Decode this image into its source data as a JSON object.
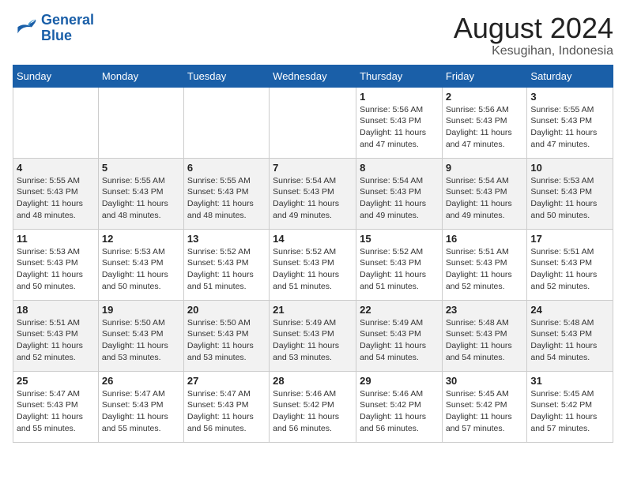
{
  "logo": {
    "text_general": "General",
    "text_blue": "Blue"
  },
  "title": {
    "month_year": "August 2024",
    "location": "Kesugihan, Indonesia"
  },
  "weekdays": [
    "Sunday",
    "Monday",
    "Tuesday",
    "Wednesday",
    "Thursday",
    "Friday",
    "Saturday"
  ],
  "weeks": [
    [
      {
        "day": "",
        "info": ""
      },
      {
        "day": "",
        "info": ""
      },
      {
        "day": "",
        "info": ""
      },
      {
        "day": "",
        "info": ""
      },
      {
        "day": "1",
        "info": "Sunrise: 5:56 AM\nSunset: 5:43 PM\nDaylight: 11 hours\nand 47 minutes."
      },
      {
        "day": "2",
        "info": "Sunrise: 5:56 AM\nSunset: 5:43 PM\nDaylight: 11 hours\nand 47 minutes."
      },
      {
        "day": "3",
        "info": "Sunrise: 5:55 AM\nSunset: 5:43 PM\nDaylight: 11 hours\nand 47 minutes."
      }
    ],
    [
      {
        "day": "4",
        "info": "Sunrise: 5:55 AM\nSunset: 5:43 PM\nDaylight: 11 hours\nand 48 minutes."
      },
      {
        "day": "5",
        "info": "Sunrise: 5:55 AM\nSunset: 5:43 PM\nDaylight: 11 hours\nand 48 minutes."
      },
      {
        "day": "6",
        "info": "Sunrise: 5:55 AM\nSunset: 5:43 PM\nDaylight: 11 hours\nand 48 minutes."
      },
      {
        "day": "7",
        "info": "Sunrise: 5:54 AM\nSunset: 5:43 PM\nDaylight: 11 hours\nand 49 minutes."
      },
      {
        "day": "8",
        "info": "Sunrise: 5:54 AM\nSunset: 5:43 PM\nDaylight: 11 hours\nand 49 minutes."
      },
      {
        "day": "9",
        "info": "Sunrise: 5:54 AM\nSunset: 5:43 PM\nDaylight: 11 hours\nand 49 minutes."
      },
      {
        "day": "10",
        "info": "Sunrise: 5:53 AM\nSunset: 5:43 PM\nDaylight: 11 hours\nand 50 minutes."
      }
    ],
    [
      {
        "day": "11",
        "info": "Sunrise: 5:53 AM\nSunset: 5:43 PM\nDaylight: 11 hours\nand 50 minutes."
      },
      {
        "day": "12",
        "info": "Sunrise: 5:53 AM\nSunset: 5:43 PM\nDaylight: 11 hours\nand 50 minutes."
      },
      {
        "day": "13",
        "info": "Sunrise: 5:52 AM\nSunset: 5:43 PM\nDaylight: 11 hours\nand 51 minutes."
      },
      {
        "day": "14",
        "info": "Sunrise: 5:52 AM\nSunset: 5:43 PM\nDaylight: 11 hours\nand 51 minutes."
      },
      {
        "day": "15",
        "info": "Sunrise: 5:52 AM\nSunset: 5:43 PM\nDaylight: 11 hours\nand 51 minutes."
      },
      {
        "day": "16",
        "info": "Sunrise: 5:51 AM\nSunset: 5:43 PM\nDaylight: 11 hours\nand 52 minutes."
      },
      {
        "day": "17",
        "info": "Sunrise: 5:51 AM\nSunset: 5:43 PM\nDaylight: 11 hours\nand 52 minutes."
      }
    ],
    [
      {
        "day": "18",
        "info": "Sunrise: 5:51 AM\nSunset: 5:43 PM\nDaylight: 11 hours\nand 52 minutes."
      },
      {
        "day": "19",
        "info": "Sunrise: 5:50 AM\nSunset: 5:43 PM\nDaylight: 11 hours\nand 53 minutes."
      },
      {
        "day": "20",
        "info": "Sunrise: 5:50 AM\nSunset: 5:43 PM\nDaylight: 11 hours\nand 53 minutes."
      },
      {
        "day": "21",
        "info": "Sunrise: 5:49 AM\nSunset: 5:43 PM\nDaylight: 11 hours\nand 53 minutes."
      },
      {
        "day": "22",
        "info": "Sunrise: 5:49 AM\nSunset: 5:43 PM\nDaylight: 11 hours\nand 54 minutes."
      },
      {
        "day": "23",
        "info": "Sunrise: 5:48 AM\nSunset: 5:43 PM\nDaylight: 11 hours\nand 54 minutes."
      },
      {
        "day": "24",
        "info": "Sunrise: 5:48 AM\nSunset: 5:43 PM\nDaylight: 11 hours\nand 54 minutes."
      }
    ],
    [
      {
        "day": "25",
        "info": "Sunrise: 5:47 AM\nSunset: 5:43 PM\nDaylight: 11 hours\nand 55 minutes."
      },
      {
        "day": "26",
        "info": "Sunrise: 5:47 AM\nSunset: 5:43 PM\nDaylight: 11 hours\nand 55 minutes."
      },
      {
        "day": "27",
        "info": "Sunrise: 5:47 AM\nSunset: 5:43 PM\nDaylight: 11 hours\nand 56 minutes."
      },
      {
        "day": "28",
        "info": "Sunrise: 5:46 AM\nSunset: 5:42 PM\nDaylight: 11 hours\nand 56 minutes."
      },
      {
        "day": "29",
        "info": "Sunrise: 5:46 AM\nSunset: 5:42 PM\nDaylight: 11 hours\nand 56 minutes."
      },
      {
        "day": "30",
        "info": "Sunrise: 5:45 AM\nSunset: 5:42 PM\nDaylight: 11 hours\nand 57 minutes."
      },
      {
        "day": "31",
        "info": "Sunrise: 5:45 AM\nSunset: 5:42 PM\nDaylight: 11 hours\nand 57 minutes."
      }
    ]
  ]
}
